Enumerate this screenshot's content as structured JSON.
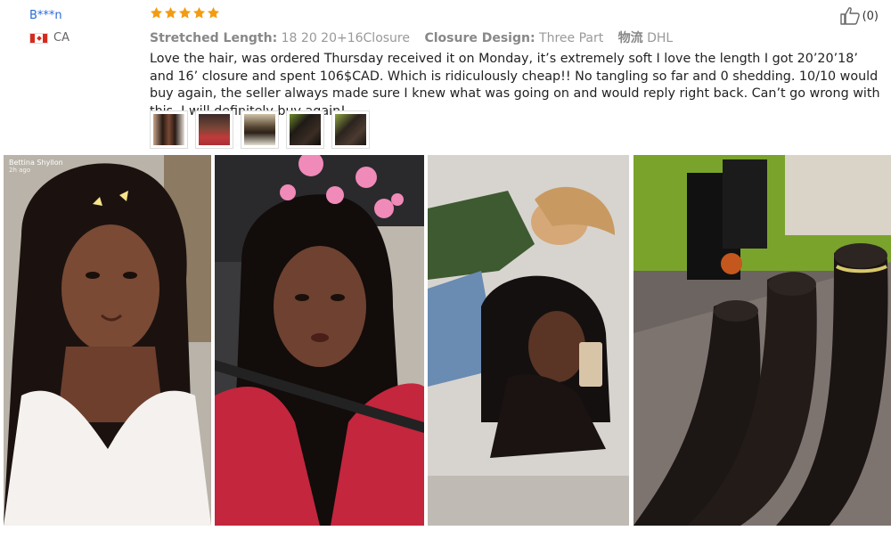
{
  "reviewer": {
    "name": "B***n",
    "country": "CA"
  },
  "rating": {
    "stars": 5,
    "color": "#f39c12"
  },
  "helpful": {
    "count": "(0)"
  },
  "specs": [
    {
      "label": "Stretched Length:",
      "value": "18 20 20+16Closure"
    },
    {
      "label": "Closure Design:",
      "value": "Three Part"
    },
    {
      "label": "物流",
      "value": "DHL"
    }
  ],
  "review_text": "Love the hair, was ordered Thursday received it on Monday, it’s extremely soft I love the length I got 20’20’18’ and 16’ closure and spent 106$CAD. Which is ridiculously cheap!! No tangling so far and 0 shedding. 10/10 would buy again, the seller always made sure I knew what was going on and would reply right back. Can’t go wrong with this, I will definitely buy again!",
  "thumbnails": [
    "selfie-1",
    "selfie-2",
    "hair-bundle",
    "hair-dark",
    "hair-bundles-table"
  ],
  "photos": [
    {
      "subject": "selfie-with-filter",
      "caption_name": "Bettina Shyllon",
      "caption_time": "2h ago"
    },
    {
      "subject": "car-selfie-with-hearts",
      "caption_name": "",
      "caption_time": ""
    },
    {
      "subject": "mirror-selfie",
      "caption_name": "",
      "caption_time": ""
    },
    {
      "subject": "hair-bundles",
      "caption_name": "",
      "caption_time": ""
    }
  ],
  "colors": {
    "name_link": "#2b6bd6",
    "star": "#f39c12",
    "accent_green": "#6a9a1f"
  }
}
